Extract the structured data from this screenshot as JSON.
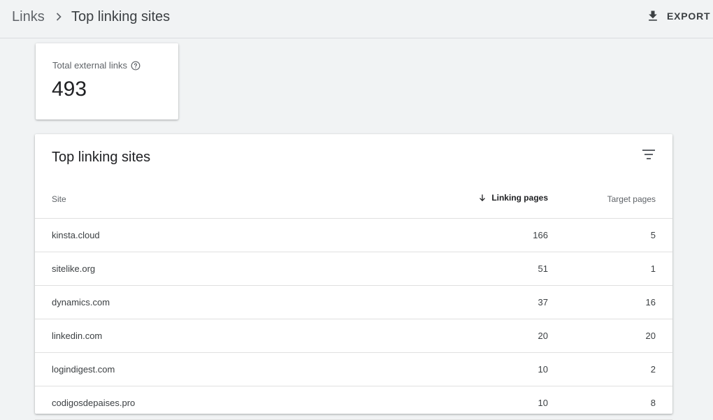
{
  "header": {
    "breadcrumb_root": "Links",
    "breadcrumb_current": "Top linking sites",
    "export_label": "EXPORT"
  },
  "summary": {
    "label": "Total external links",
    "value": "493"
  },
  "table": {
    "title": "Top linking sites",
    "columns": {
      "site": "Site",
      "linking_pages": "Linking pages",
      "target_pages": "Target pages"
    },
    "sort": {
      "column": "linking_pages",
      "direction": "descending"
    },
    "rows": [
      {
        "site": "kinsta.cloud",
        "linking_pages": "166",
        "target_pages": "5"
      },
      {
        "site": "sitelike.org",
        "linking_pages": "51",
        "target_pages": "1"
      },
      {
        "site": "dynamics.com",
        "linking_pages": "37",
        "target_pages": "16"
      },
      {
        "site": "linkedin.com",
        "linking_pages": "20",
        "target_pages": "20"
      },
      {
        "site": "logindigest.com",
        "linking_pages": "10",
        "target_pages": "2"
      },
      {
        "site": "codigosdepaises.pro",
        "linking_pages": "10",
        "target_pages": "8"
      }
    ]
  },
  "icons": {
    "chevron": "chevron-right-icon",
    "export": "download-icon",
    "help": "help-circle-icon",
    "filter": "filter-list-icon",
    "sort": "arrow-down-icon"
  },
  "colors": {
    "background": "#f1f3f4",
    "card": "#ffffff",
    "text_primary": "#202124",
    "text_secondary": "#5f6368",
    "divider": "#e0e0e0"
  }
}
